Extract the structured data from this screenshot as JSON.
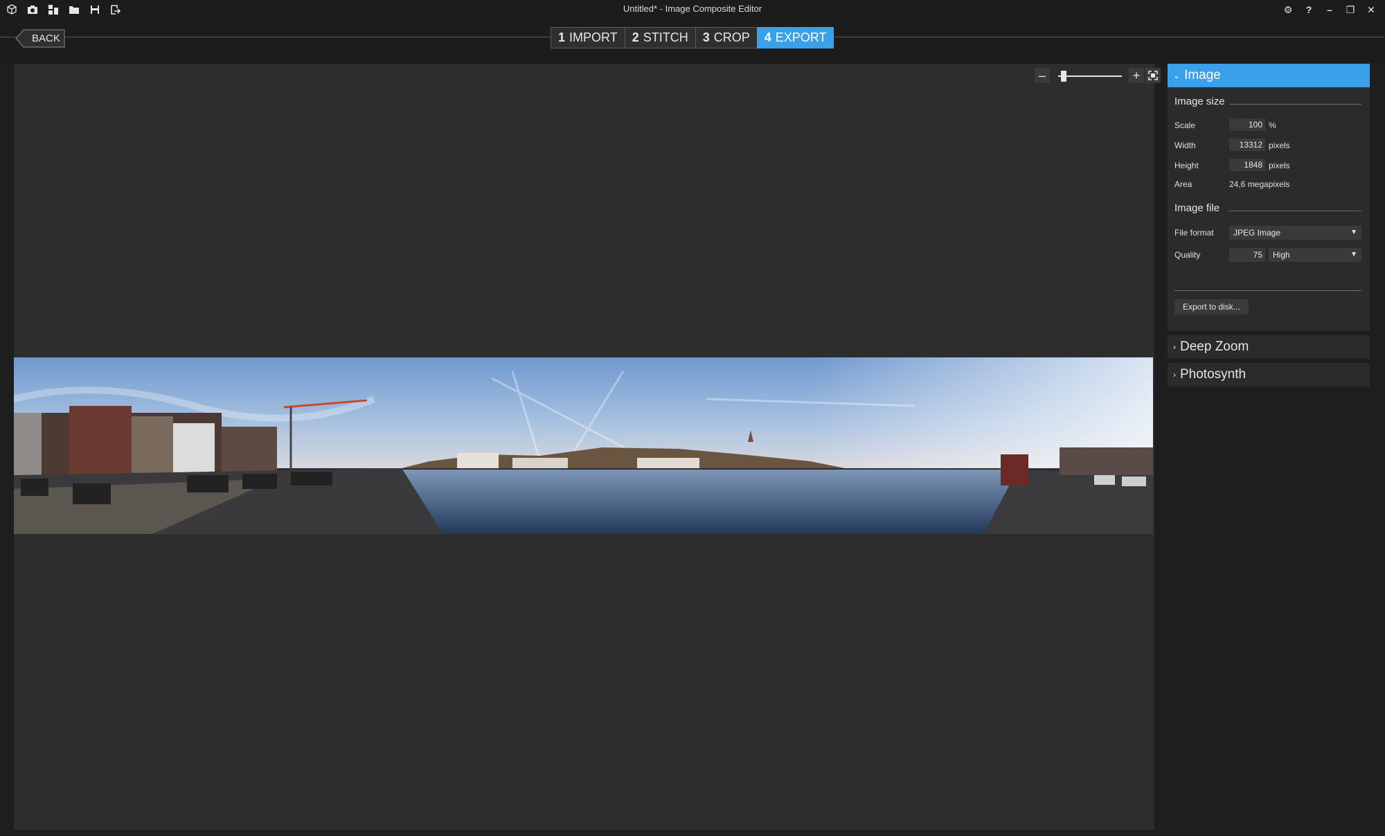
{
  "window": {
    "title": "Untitled* - Image Composite Editor"
  },
  "toolbar": {
    "icons": [
      "new-project-icon",
      "camera-icon",
      "stitch-icon",
      "open-folder-icon",
      "save-icon",
      "export-icon"
    ]
  },
  "window_controls": {
    "settings": "⚙",
    "help": "?",
    "minimize": "–",
    "maximize": "❐",
    "close": "✕"
  },
  "nav": {
    "back_label": "BACK",
    "steps": [
      {
        "num": "1",
        "label": "IMPORT"
      },
      {
        "num": "2",
        "label": "STITCH"
      },
      {
        "num": "3",
        "label": "CROP"
      },
      {
        "num": "4",
        "label": "EXPORT",
        "active": true
      }
    ]
  },
  "zoom": {
    "minus": "–",
    "plus": "+",
    "level": 0.05
  },
  "panel": {
    "image_section": {
      "title": "Image",
      "image_size": {
        "title": "Image size",
        "scale_label": "Scale",
        "scale_value": "100",
        "scale_unit": "%",
        "width_label": "Width",
        "width_value": "13312",
        "width_unit": "pixels",
        "height_label": "Height",
        "height_value": "1848",
        "height_unit": "pixels",
        "area_label": "Area",
        "area_value": "24,6 megapixels"
      },
      "image_file": {
        "title": "Image file",
        "format_label": "File format",
        "format_value": "JPEG Image",
        "quality_label": "Quality",
        "quality_value": "75",
        "quality_level": "High"
      },
      "export_button": "Export to disk..."
    },
    "deep_zoom_title": "Deep Zoom",
    "photosynth_title": "Photosynth"
  },
  "colors": {
    "accent": "#3aa0ea",
    "background": "#1e1e1e",
    "canvas": "#2d2d2d"
  }
}
